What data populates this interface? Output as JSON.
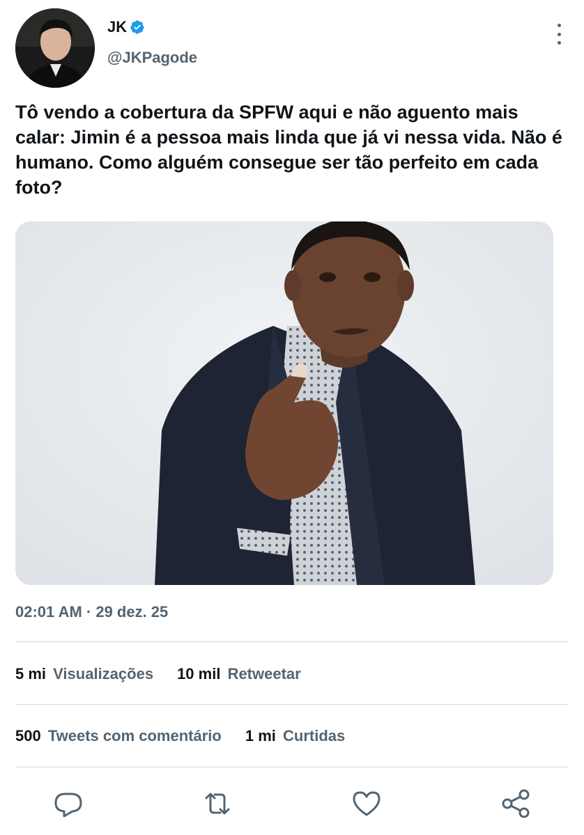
{
  "author": {
    "display_name": "JK",
    "handle": "@JKPagode",
    "verified": true,
    "verified_color": "#1d9bf0"
  },
  "tweet": {
    "text": "Tô vendo a cobertura da SPFW aqui e não aguento mais calar: Jimin é a pessoa mais linda que já vi nessa vida. Não é humano. Como alguém consegue ser tão perfeito em cada foto?",
    "timestamp": "02:01 AM · 29 dez. 25"
  },
  "stats": {
    "views": {
      "count": "5 mi",
      "label": "Visualizações"
    },
    "retweets": {
      "count": "10 mil",
      "label": "Retweetar"
    },
    "quotes": {
      "count": "500",
      "label": "Tweets com comentário"
    },
    "likes": {
      "count": "1 mi",
      "label": "Curtidas"
    }
  },
  "icons": {
    "reply": "reply-icon",
    "retweet": "retweet-icon",
    "like": "heart-icon",
    "share": "share-icon",
    "more": "more-options-icon"
  },
  "colors": {
    "secondary_text": "#536471",
    "divider": "#cfd9de",
    "icon": "#536471"
  }
}
